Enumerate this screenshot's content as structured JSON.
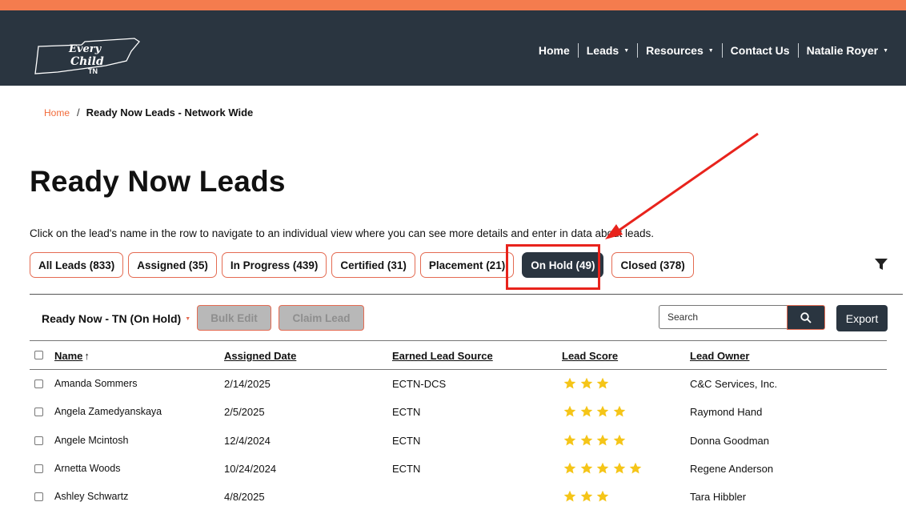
{
  "header": {
    "logo_text": [
      "Every",
      "Child",
      "TN"
    ],
    "nav": [
      {
        "label": "Home",
        "has_caret": false
      },
      {
        "label": "Leads",
        "has_caret": true
      },
      {
        "label": "Resources",
        "has_caret": true
      },
      {
        "label": "Contact Us",
        "has_caret": false
      },
      {
        "label": "Natalie Royer",
        "has_caret": true
      }
    ]
  },
  "breadcrumb": {
    "home": "Home",
    "separator": "/",
    "current": "Ready Now Leads - Network Wide"
  },
  "page": {
    "title": "Ready Now Leads",
    "description": "Click on the lead's name in the row to navigate to an individual view where you can see more details and enter in data about leads."
  },
  "tabs": [
    {
      "label": "All Leads (833)",
      "active": false
    },
    {
      "label": "Assigned (35)",
      "active": false
    },
    {
      "label": "In Progress (439)",
      "active": false
    },
    {
      "label": "Certified (31)",
      "active": false
    },
    {
      "label": "Placement (21)",
      "active": false
    },
    {
      "label": "On Hold (49)",
      "active": true
    },
    {
      "label": "Closed (378)",
      "active": false
    }
  ],
  "toolbar": {
    "view_label": "Ready Now - TN (On Hold)",
    "bulk_edit": "Bulk Edit",
    "claim_lead": "Claim Lead",
    "search_placeholder": "Search",
    "export": "Export"
  },
  "table": {
    "columns": [
      "Name",
      "Assigned Date",
      "Earned Lead Source",
      "Lead Score",
      "Lead Owner"
    ],
    "sort_indicator": "↑",
    "rows": [
      {
        "name": "Amanda Sommers",
        "assigned_date": "2/14/2025",
        "source": "ECTN-DCS",
        "score": 3,
        "owner": "C&C Services, Inc."
      },
      {
        "name": "Angela Zamedyanskaya",
        "assigned_date": "2/5/2025",
        "source": "ECTN",
        "score": 4,
        "owner": "Raymond Hand"
      },
      {
        "name": "Angele Mcintosh",
        "assigned_date": "12/4/2024",
        "source": "ECTN",
        "score": 4,
        "owner": "Donna Goodman"
      },
      {
        "name": "Arnetta Woods",
        "assigned_date": "10/24/2024",
        "source": "ECTN",
        "score": 5,
        "owner": "Regene Anderson"
      },
      {
        "name": "Ashley Schwartz",
        "assigned_date": "4/8/2025",
        "source": "",
        "score": 3,
        "owner": "Tara Hibbler"
      }
    ]
  },
  "colors": {
    "brand_orange": "#f47c4e",
    "navbar": "#2a3540",
    "star": "#f5c518",
    "annotation_red": "#e8231c"
  }
}
